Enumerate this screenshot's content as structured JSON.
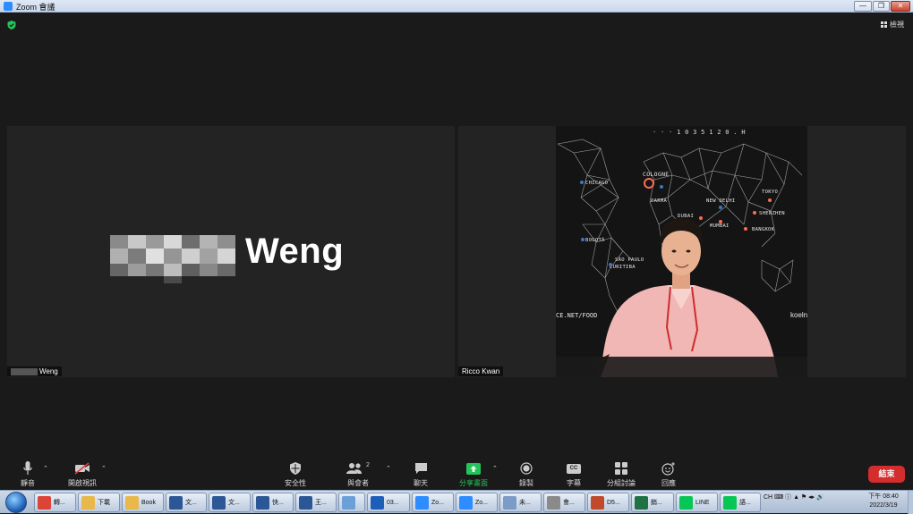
{
  "window": {
    "title": "Zoom 會議",
    "controls": [
      "—",
      "❐",
      "✕"
    ]
  },
  "top": {
    "view_label": "檢視"
  },
  "participants": [
    {
      "big_name": "Weng",
      "label": "Weng"
    },
    {
      "label": "Ricco Kwan"
    }
  ],
  "video_text": {
    "cities": [
      "CHICAGO",
      "COLOGNE",
      "PARMA",
      "DUBAI",
      "NEW DELHI",
      "MUMBAI",
      "TOKYO",
      "SHENZHEN",
      "BANGKOK",
      "BOGOTÁ",
      "SÃO PAULO",
      "CURITIBA"
    ],
    "url": "CE.NET/FOOD",
    "brand": "koeln",
    "top_text": "· · ·   1 0 3 5 1 2 0 .  H"
  },
  "toolbar": {
    "mute": "靜音",
    "video": "開啟視訊",
    "security": "安全性",
    "participants": "與會者",
    "participant_count": "2",
    "chat": "聊天",
    "share": "分享畫面",
    "record": "錄製",
    "captions": "字幕",
    "breakout": "分組討論",
    "reactions": "回應",
    "end": "結束",
    "cc_glyph": "CC"
  },
  "taskbar": {
    "items": [
      {
        "icon": "chrome-icon",
        "label": "轉...",
        "color": "#db4437"
      },
      {
        "icon": "folder-icon",
        "label": "下載",
        "color": "#e8b84a"
      },
      {
        "icon": "folder-icon",
        "label": "Book",
        "color": "#e8b84a"
      },
      {
        "icon": "word-icon",
        "label": "文...",
        "color": "#2b5797"
      },
      {
        "icon": "word-icon",
        "label": "文...",
        "color": "#2b5797"
      },
      {
        "icon": "word-icon",
        "label": "快...",
        "color": "#2b5797"
      },
      {
        "icon": "word-icon",
        "label": "王...",
        "color": "#2b5797"
      },
      {
        "icon": "paint-icon",
        "label": "",
        "color": "#6aa0d8"
      },
      {
        "icon": "audio-icon",
        "label": "03...",
        "color": "#1d5fb8"
      },
      {
        "icon": "zoom-icon",
        "label": "Zo...",
        "color": "#2d8cff"
      },
      {
        "icon": "zoom-icon",
        "label": "Zo...",
        "color": "#2d8cff"
      },
      {
        "icon": "notepad-icon",
        "label": "未...",
        "color": "#7a9cc6"
      },
      {
        "icon": "app-icon",
        "label": "會...",
        "color": "#8a8a8a"
      },
      {
        "icon": "image-icon",
        "label": "D5...",
        "color": "#c04a2a"
      },
      {
        "icon": "excel-icon",
        "label": "銷...",
        "color": "#1f7244"
      },
      {
        "icon": "line-icon",
        "label": "LINE",
        "color": "#06c755"
      },
      {
        "icon": "phone-icon",
        "label": "語...",
        "color": "#06c755"
      }
    ],
    "tray_lang": "CH",
    "time": "下午 08:40",
    "date": "2022/3/19"
  }
}
